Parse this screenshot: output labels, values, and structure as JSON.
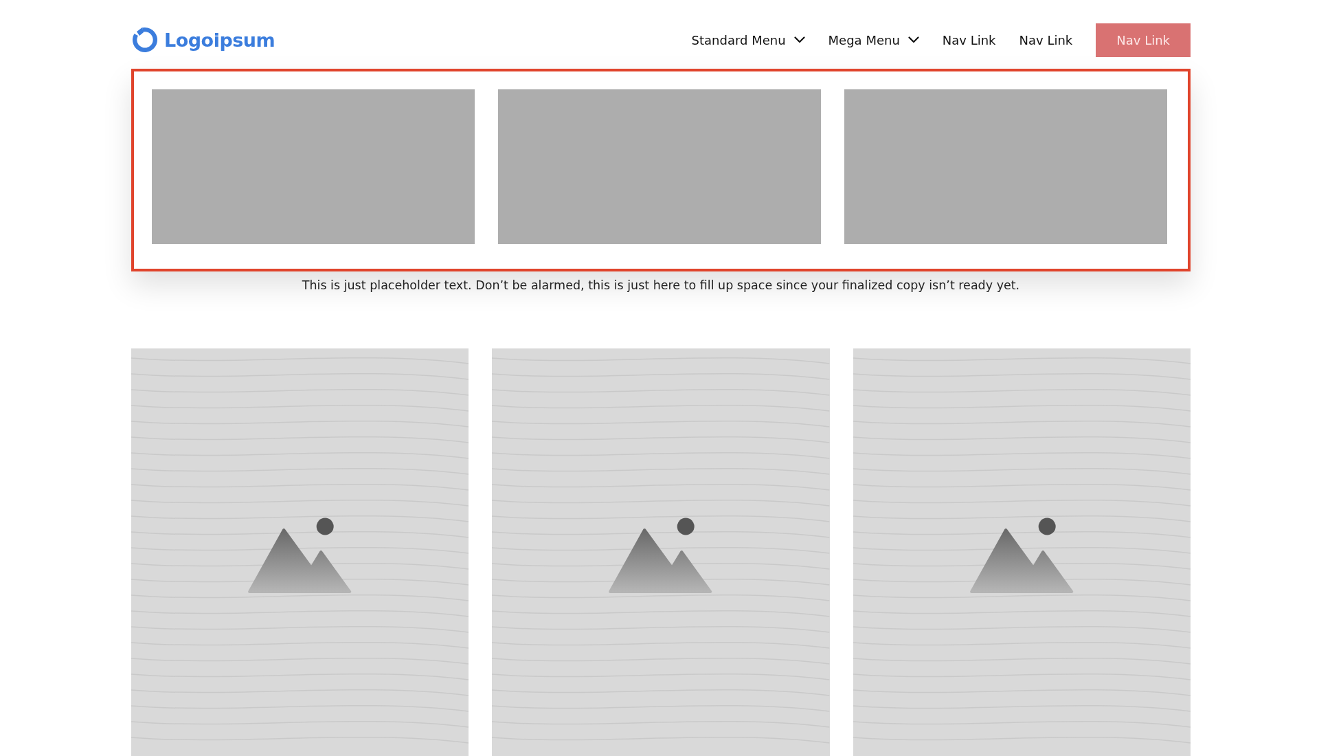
{
  "logo": {
    "text": "Logoipsum"
  },
  "nav": [
    {
      "kind": "dropdown",
      "label": "Standard Menu"
    },
    {
      "kind": "dropdown",
      "label": "Mega Menu"
    },
    {
      "kind": "link",
      "label": "Nav Link"
    },
    {
      "kind": "link",
      "label": "Nav Link"
    },
    {
      "kind": "button",
      "label": "Nav Link"
    }
  ],
  "mega_menu": {
    "panels": [
      {
        "kind": "placeholder"
      },
      {
        "kind": "placeholder"
      },
      {
        "kind": "placeholder"
      }
    ],
    "caption": "This is just placeholder text. Don’t be alarmed, this is just here to fill up space since your finalized copy isn’t ready yet."
  },
  "cards": [
    {
      "kind": "image-placeholder"
    },
    {
      "kind": "image-placeholder"
    },
    {
      "kind": "image-placeholder"
    }
  ]
}
